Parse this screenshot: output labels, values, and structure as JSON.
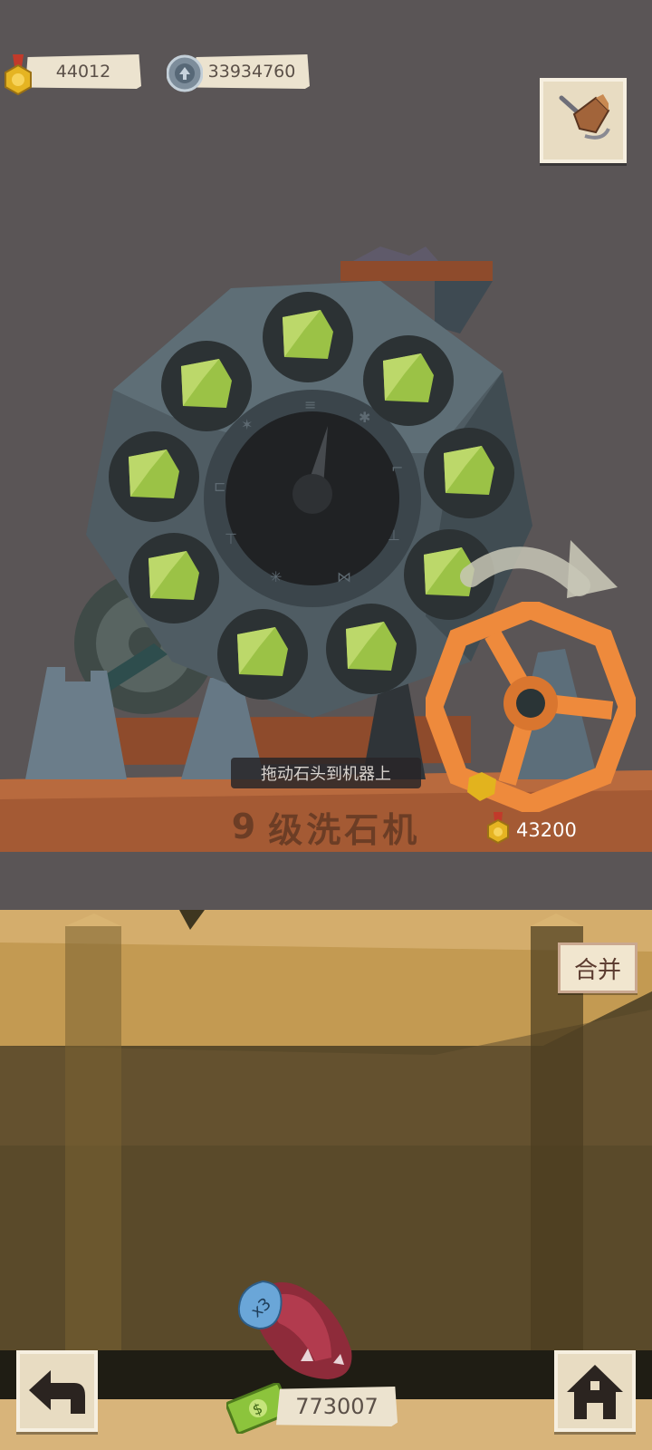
{
  "currencies": {
    "medals": "44012",
    "gears": "33934760"
  },
  "machine": {
    "drag_hint": "拖动石头到机器上",
    "level_number": "9",
    "level_label": "级洗石机",
    "upgrade_cost": "43200",
    "stone_count": 9
  },
  "bin": {
    "merge_label": "合并"
  },
  "bag": {
    "multiplier": "x3"
  },
  "bottom_bar": {
    "cash": "773007"
  },
  "colors": {
    "background": "#5a5556",
    "wood": "#a45a34",
    "wheel_orange": "#ee8a3c",
    "stone_green": "#9bc246"
  },
  "icons": {
    "medal": "medal-icon",
    "gear": "gear-coin-icon",
    "shop": "pickaxe-shop-icon",
    "back": "back-arrow-icon",
    "home": "house-icon",
    "cash": "cash-bill-icon"
  }
}
